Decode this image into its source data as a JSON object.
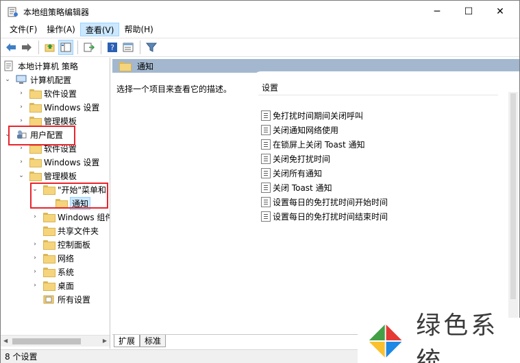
{
  "window": {
    "title": "本地组策略编辑器",
    "minimize_glyph": "─",
    "maximize_glyph": "☐",
    "close_glyph": "✕"
  },
  "menubar": {
    "items": [
      "文件(F)",
      "操作(A)",
      "查看(V)",
      "帮助(H)"
    ],
    "active": "查看(V)"
  },
  "toolbar": {
    "icons": [
      "back-icon",
      "forward-icon",
      "up-folder-icon",
      "show-hide-tree-icon",
      "export-list-icon",
      "help-icon",
      "properties-icon",
      "filter-icon"
    ]
  },
  "tree": {
    "root": "本地计算机 策略",
    "computer_config": "计算机配置",
    "cc_software": "软件设置",
    "cc_windows": "Windows 设置",
    "cc_admin": "管理模板",
    "user_config": "用户配置",
    "uc_software": "软件设置",
    "uc_windows": "Windows 设置",
    "uc_admin": "管理模板",
    "start_menu": "\"开始\"菜单和",
    "notify": "通知",
    "windows_components": "Windows 组件",
    "shared_folders": "共享文件夹",
    "control_panel": "控制面板",
    "network": "网络",
    "system": "系统",
    "desktop": "桌面",
    "all_settings": "所有设置"
  },
  "right": {
    "header_title": "通知",
    "description": "选择一个项目来查看它的描述。",
    "list_header": "设置",
    "settings": [
      "免打扰时间期间关闭呼叫",
      "关闭通知网络使用",
      "在锁屏上关闭 Toast 通知",
      "关闭免打扰时间",
      "关闭所有通知",
      "关闭 Toast 通知",
      "设置每日的免打扰时间开始时间",
      "设置每日的免打扰时间结束时间"
    ],
    "tabs": [
      "扩展",
      "标准"
    ],
    "active_tab": "扩展"
  },
  "status": {
    "text": "8 个设置"
  },
  "watermark": {
    "text": "绿色系统"
  },
  "colors": {
    "header_band": "#a3b8cf",
    "highlight_box": "#e8242b",
    "selection": "#cce8ff"
  }
}
